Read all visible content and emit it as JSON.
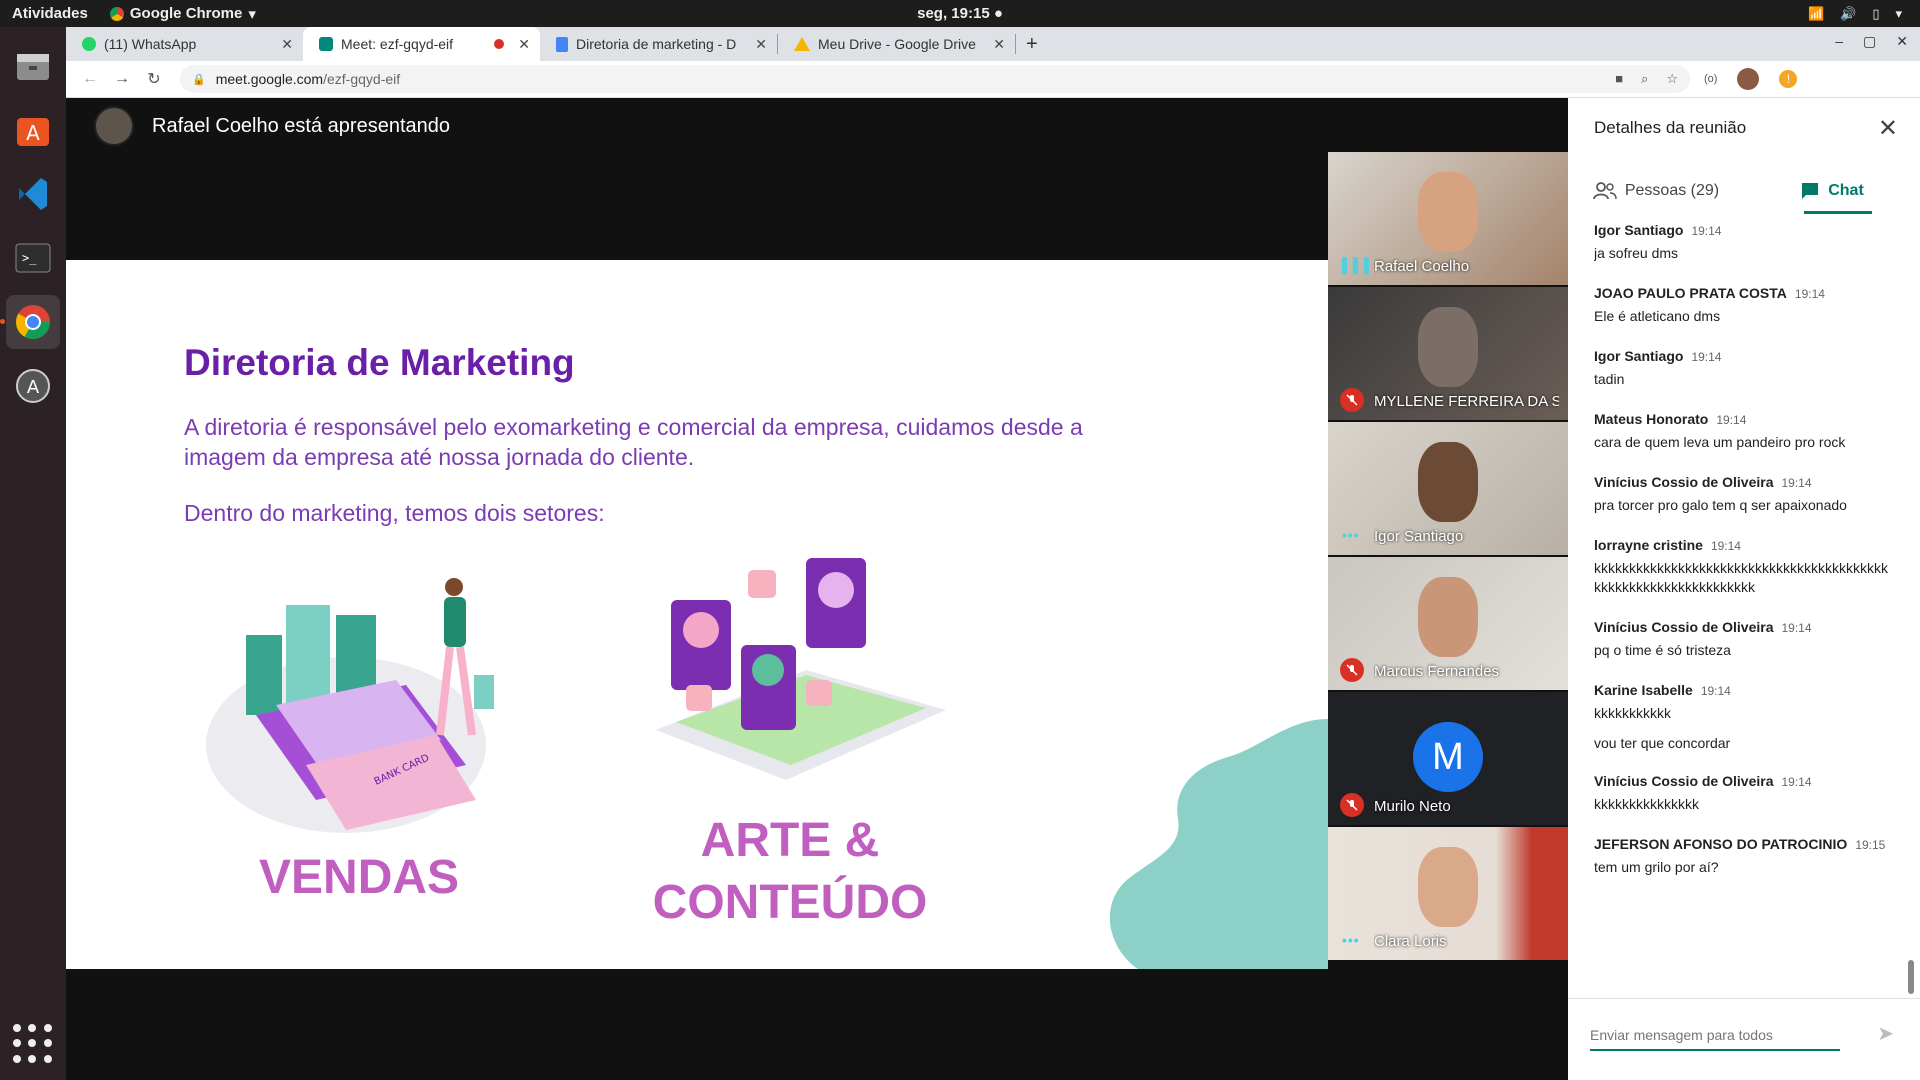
{
  "system": {
    "activities": "Atividades",
    "app_name": "Google Chrome",
    "clock": "seg, 19:15 ●"
  },
  "browser": {
    "tabs": [
      {
        "label": "(11) WhatsApp"
      },
      {
        "label": "Meet: ezf-gqyd-eif"
      },
      {
        "label": "Diretoria de marketing - D"
      },
      {
        "label": "Meu Drive - Google Drive"
      }
    ],
    "url_host": "meet.google.com",
    "url_path": "/ezf-gqyd-eif"
  },
  "meet": {
    "presenter_text": "Rafael Coelho está apresentando",
    "participants": [
      {
        "name": "Rafael Coelho",
        "state": "speaking"
      },
      {
        "name": "MYLLENE FERREIRA DA SI...",
        "state": "muted"
      },
      {
        "name": "Igor Santiago",
        "state": "speaking"
      },
      {
        "name": "Marcus Fernandes",
        "state": "muted"
      },
      {
        "name": "Murilo Neto",
        "state": "muted",
        "initial": "M"
      },
      {
        "name": "Clara Loris",
        "state": "speaking"
      }
    ]
  },
  "slide": {
    "title": "Diretoria de Marketing",
    "body1": "A diretoria é responsável pelo exomarketing e comercial da empresa, cuidamos desde a imagem da empresa até nossa jornada do cliente.",
    "body2": "Dentro do marketing, temos dois setores:",
    "sector1": "VENDAS",
    "sector2_line1": "ARTE &",
    "sector2_line2": "CONTEÚDO",
    "card_text": "BANK CARD",
    "colors": {
      "title": "#6a1fa7",
      "accent": "#c15fc0",
      "blob": "#8dd0c8"
    }
  },
  "panel": {
    "title": "Detalhes da reunião",
    "tab_people": "Pessoas (29)",
    "tab_chat": "Chat",
    "messages": [
      {
        "author": "Igor Santiago",
        "time": "19:14",
        "text": "ja sofreu dms"
      },
      {
        "author": "JOAO PAULO PRATA COSTA",
        "time": "19:14",
        "text": "Ele é atleticano dms"
      },
      {
        "author": "Igor Santiago",
        "time": "19:14",
        "text": "tadin"
      },
      {
        "author": "Mateus Honorato",
        "time": "19:14",
        "text": "cara de quem leva um pandeiro pro rock"
      },
      {
        "author": "Vinícius Cossio de Oliveira",
        "time": "19:14",
        "text": "pra torcer pro galo tem q ser apaixonado"
      },
      {
        "author": "lorrayne cristine",
        "time": "19:14",
        "text": "kkkkkkkkkkkkkkkkkkkkkkkkkkkkkkkkkkkkkkkkkkkkkkkkkkkkkkkkkkkkkkkkk"
      },
      {
        "author": "Vinícius Cossio de Oliveira",
        "time": "19:14",
        "text": "pq o time é só tristeza"
      },
      {
        "author": "Karine Isabelle",
        "time": "19:14",
        "text": "kkkkkkkkkkk",
        "text2": "vou ter que concordar"
      },
      {
        "author": "Vinícius Cossio de Oliveira",
        "time": "19:14",
        "text": "kkkkkkkkkkkkkkk"
      },
      {
        "author": "JEFERSON AFONSO DO PATROCINIO",
        "time": "19:15",
        "text": "tem um grilo por aí?"
      }
    ],
    "compose_placeholder": "Enviar mensagem para todos"
  }
}
